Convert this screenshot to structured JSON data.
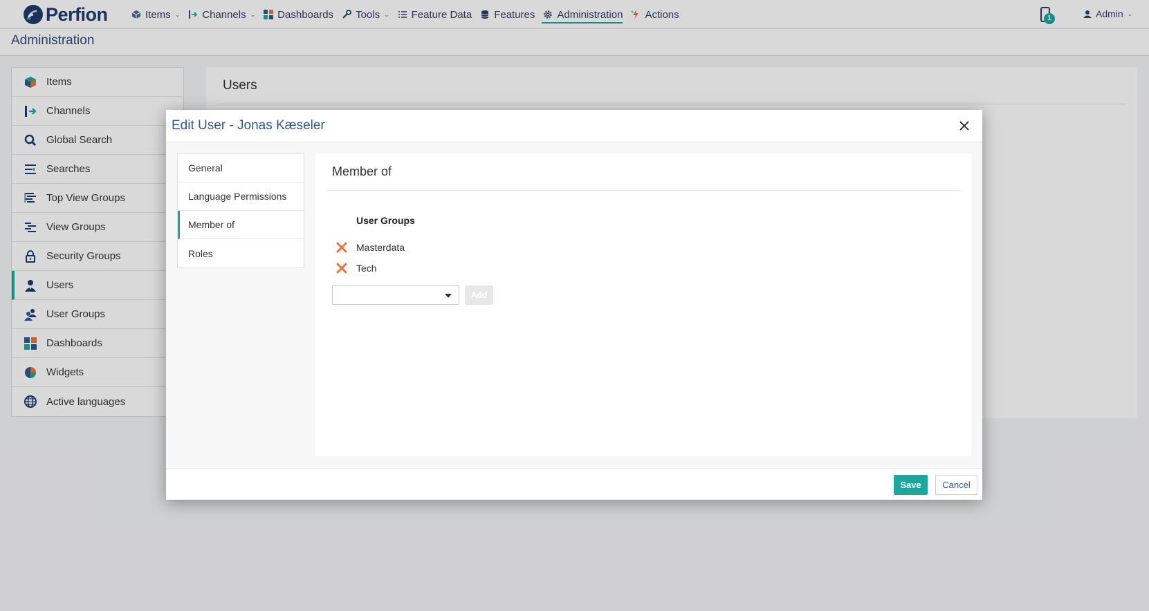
{
  "app": {
    "logo_text": "Perfion"
  },
  "nav": {
    "items": [
      {
        "label": "Items",
        "icon": "cube-icon",
        "has_dropdown": true
      },
      {
        "label": "Channels",
        "icon": "channels-icon",
        "has_dropdown": true
      },
      {
        "label": "Dashboards",
        "icon": "dashboard-icon",
        "has_dropdown": false
      },
      {
        "label": "Tools",
        "icon": "wrench-icon",
        "has_dropdown": true
      },
      {
        "label": "Feature Data",
        "icon": "list-icon",
        "has_dropdown": false
      },
      {
        "label": "Features",
        "icon": "database-icon",
        "has_dropdown": false
      },
      {
        "label": "Administration",
        "icon": "gear-icon",
        "has_dropdown": false,
        "active": true
      },
      {
        "label": "Actions",
        "icon": "lightning-icon",
        "has_dropdown": false
      }
    ],
    "notification_count": "1",
    "user_menu_label": "Admin"
  },
  "page": {
    "title": "Administration"
  },
  "sidebar": {
    "items": [
      {
        "label": "Items",
        "icon": "cube-icon"
      },
      {
        "label": "Channels",
        "icon": "channels-icon"
      },
      {
        "label": "Global Search",
        "icon": "search-icon"
      },
      {
        "label": "Searches",
        "icon": "searches-list-icon"
      },
      {
        "label": "Top View Groups",
        "icon": "top-view-groups-icon"
      },
      {
        "label": "View Groups",
        "icon": "view-groups-icon"
      },
      {
        "label": "Security Groups",
        "icon": "lock-icon"
      },
      {
        "label": "Users",
        "icon": "user-icon",
        "active": true
      },
      {
        "label": "User Groups",
        "icon": "user-groups-icon"
      },
      {
        "label": "Dashboards",
        "icon": "dashboard-icon"
      },
      {
        "label": "Widgets",
        "icon": "pie-chart-icon"
      },
      {
        "label": "Active languages",
        "icon": "globe-icon"
      }
    ]
  },
  "main": {
    "title": "Users"
  },
  "modal": {
    "title": "Edit User - Jonas Kæseler",
    "tabs": [
      {
        "label": "General"
      },
      {
        "label": "Language Permissions"
      },
      {
        "label": "Member of",
        "active": true
      },
      {
        "label": "Roles"
      }
    ],
    "section_title": "Member of",
    "user_groups_header": "User Groups",
    "groups": [
      {
        "name": "Masterdata"
      },
      {
        "name": "Tech"
      }
    ],
    "select_value": "",
    "add_label": "Add",
    "save_label": "Save",
    "cancel_label": "Cancel"
  },
  "colors": {
    "accent": "#1aa89d",
    "navy": "#1e3a6e",
    "link_blue": "#2c5a96",
    "remove_orange": "#e8743b"
  }
}
